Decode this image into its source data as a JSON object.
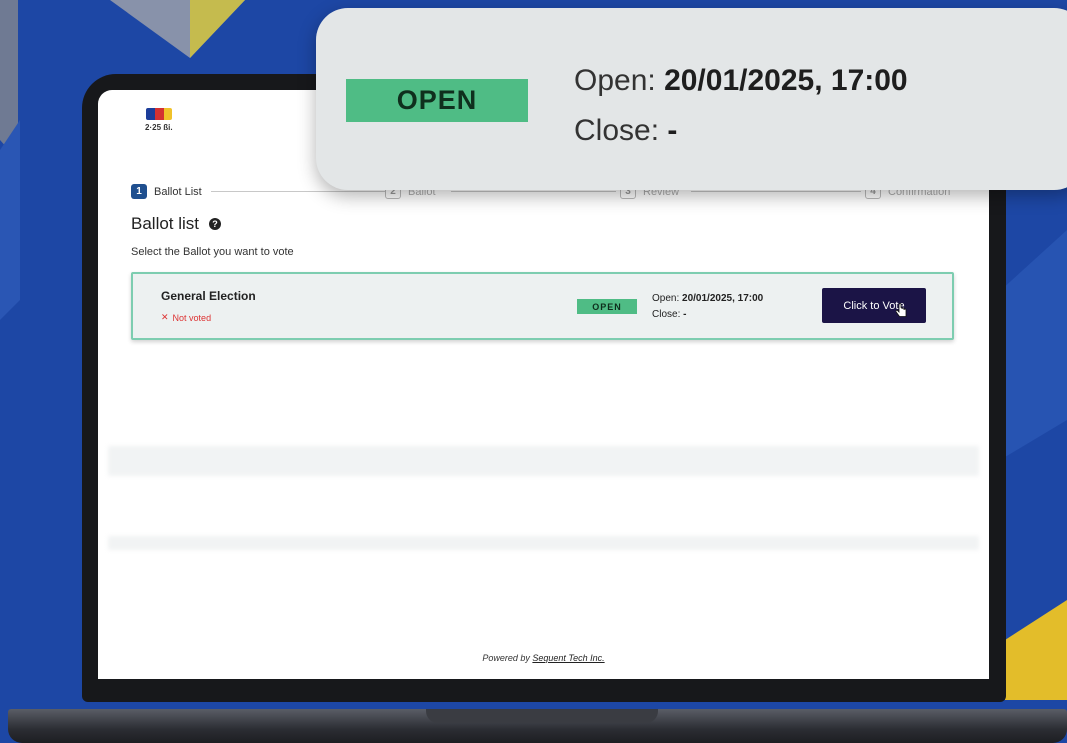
{
  "callout": {
    "badge": "OPEN",
    "open_label": "Open: ",
    "open_value": "20/01/2025, 17:00",
    "close_label": "Close: ",
    "close_value": "-"
  },
  "header": {
    "logo_text": "2·25 ßi."
  },
  "stepper": {
    "steps": [
      {
        "num": "1",
        "label": "Ballot List"
      },
      {
        "num": "2",
        "label": "Ballot"
      },
      {
        "num": "3",
        "label": "Review"
      },
      {
        "num": "4",
        "label": "Confirmation"
      }
    ]
  },
  "page": {
    "title": "Ballot list",
    "help_glyph": "?",
    "subtitle": "Select the Ballot you want to vote"
  },
  "ballot": {
    "name": "General Election",
    "status_glyph": "✕",
    "status": "Not voted",
    "badge": "OPEN",
    "open_label": "Open: ",
    "open_value": "20/01/2025, 17:00",
    "close_label": "Close: ",
    "close_value": "-",
    "button_label": "Click to Vote"
  },
  "footer": {
    "prefix": "Powered by ",
    "link": "Sequent Tech Inc."
  },
  "colors": {
    "background": "#1d47a5",
    "open_badge": "#4fbc85",
    "vote_button": "#1b1446",
    "card_border": "#7dcdb0",
    "step_active": "#1f4f8f",
    "not_voted": "#dd3333"
  }
}
